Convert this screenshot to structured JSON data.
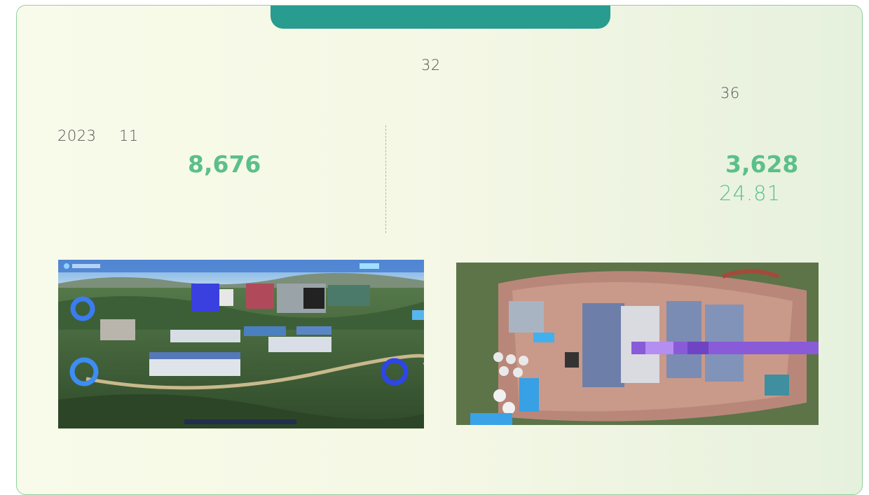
{
  "stats": {
    "top_number": "32",
    "right_number": "36",
    "year": "2023",
    "month": "11",
    "left_value": "8,676",
    "right_value": "3,628",
    "right_sub_value": "24.81"
  },
  "images": {
    "left": {
      "kind": "3d-plant-digital-twin-screenshot"
    },
    "right": {
      "kind": "aerial-photo-treatment-plant"
    }
  },
  "colors": {
    "accent": "#289c8f",
    "value_green": "#5cbf8a",
    "border": "#8fd0a0"
  }
}
